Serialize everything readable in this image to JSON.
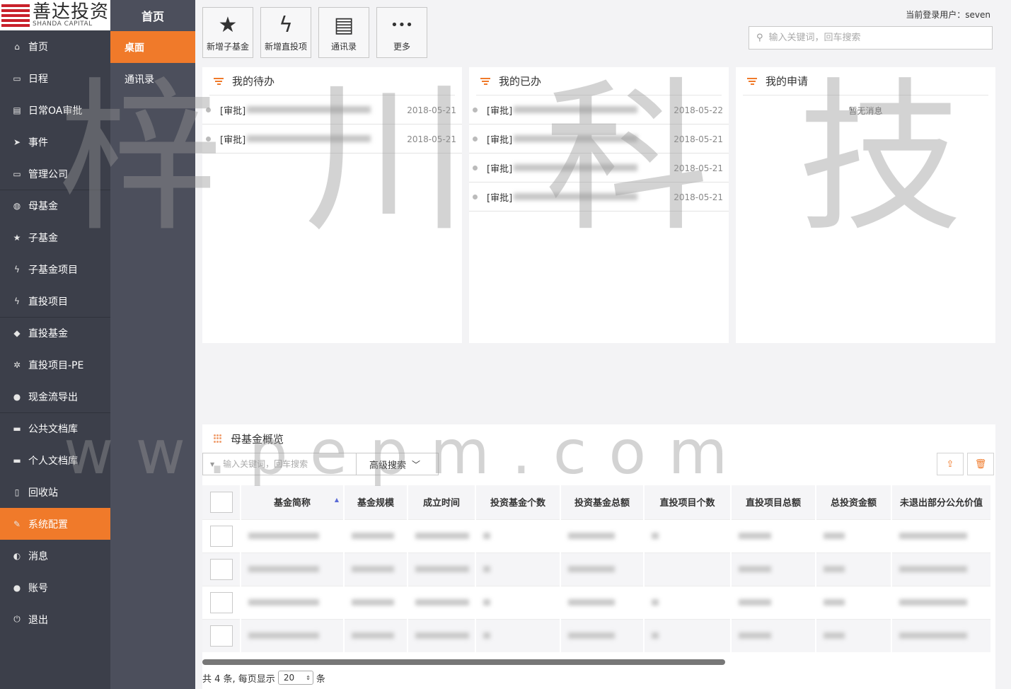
{
  "logo": {
    "cn": "善达投资",
    "en": "SHANDA CAPITAL"
  },
  "nav": [
    {
      "label": "首页",
      "icon": "home-icon",
      "glyph": "⌂"
    },
    {
      "label": "日程",
      "icon": "calendar-icon",
      "glyph": "▭"
    },
    {
      "label": "日常OA审批",
      "icon": "document-icon",
      "glyph": "▤"
    },
    {
      "label": "事件",
      "icon": "send-icon",
      "glyph": "➤"
    },
    {
      "label": "管理公司",
      "icon": "briefcase-icon",
      "glyph": "▭"
    },
    {
      "label": "母基金",
      "icon": "globe-icon",
      "glyph": "◍"
    },
    {
      "label": "子基金",
      "icon": "star-icon",
      "glyph": "★"
    },
    {
      "label": "子基金项目",
      "icon": "bolt-icon",
      "glyph": "ϟ"
    },
    {
      "label": "直投项目",
      "icon": "bolt-icon",
      "glyph": "ϟ"
    },
    {
      "label": "直投基金",
      "icon": "cube-icon",
      "glyph": "◆"
    },
    {
      "label": "直投项目-PE",
      "icon": "snowflake-icon",
      "glyph": "✲"
    },
    {
      "label": "现金流导出",
      "icon": "drop-icon",
      "glyph": "●"
    },
    {
      "label": "公共文档库",
      "icon": "folder-icon",
      "glyph": "▬"
    },
    {
      "label": "个人文档库",
      "icon": "folder-icon",
      "glyph": "▬"
    },
    {
      "label": "回收站",
      "icon": "trash-icon",
      "glyph": "▯"
    },
    {
      "label": "系统配置",
      "icon": "wrench-icon",
      "glyph": "✎"
    },
    {
      "label": "消息",
      "icon": "chat-icon",
      "glyph": "◐"
    },
    {
      "label": "账号",
      "icon": "user-icon",
      "glyph": "●"
    },
    {
      "label": "退出",
      "icon": "power-icon",
      "glyph": "⏻"
    }
  ],
  "subnav": {
    "title": "首页",
    "items": [
      "桌面",
      "通讯录"
    ]
  },
  "quick": [
    {
      "label": "新增子基金",
      "glyph": "★"
    },
    {
      "label": "新增直投项",
      "glyph": "ϟ"
    },
    {
      "label": "通讯录",
      "glyph": "▤"
    },
    {
      "label": "更多",
      "glyph": "•••"
    }
  ],
  "header": {
    "login": "当前登录用户：seven",
    "search_placeholder": "输入关键词，回车搜索"
  },
  "panels": {
    "todo": {
      "title": "我的待办",
      "items": [
        {
          "prefix": "[审批]",
          "date": "2018-05-21"
        },
        {
          "prefix": "[审批]",
          "date": "2018-05-21"
        }
      ]
    },
    "done": {
      "title": "我的已办",
      "items": [
        {
          "prefix": "[审批]",
          "date": "2018-05-22"
        },
        {
          "prefix": "[审批]",
          "date": "2018-05-21"
        },
        {
          "prefix": "[审批]",
          "date": "2018-05-21"
        },
        {
          "prefix": "[审批]",
          "date": "2018-05-21"
        }
      ]
    },
    "apply": {
      "title": "我的申请",
      "empty": "暂无消息"
    }
  },
  "fund": {
    "title": "母基金概览",
    "search_placeholder": "输入关键词，回车搜索",
    "advanced": "高级搜索",
    "columns": [
      "基金简称",
      "基金规模",
      "成立时间",
      "投资基金个数",
      "投资基金总额",
      "直投项目个数",
      "直投项目总额",
      "总投资金额",
      "未退出部分公允价值"
    ],
    "row_count": 4,
    "pager": {
      "prefix": "共 4 条, 每页显示",
      "size": "20",
      "suffix": "条"
    }
  },
  "watermark": {
    "chars": [
      "梓",
      "川",
      "科",
      "技"
    ],
    "url": "w w . p e p m . c o m"
  },
  "colors": {
    "accent": "#f07a2a",
    "nav_bg": "#3c3f4a",
    "subnav_bg": "#4c4f5c"
  }
}
